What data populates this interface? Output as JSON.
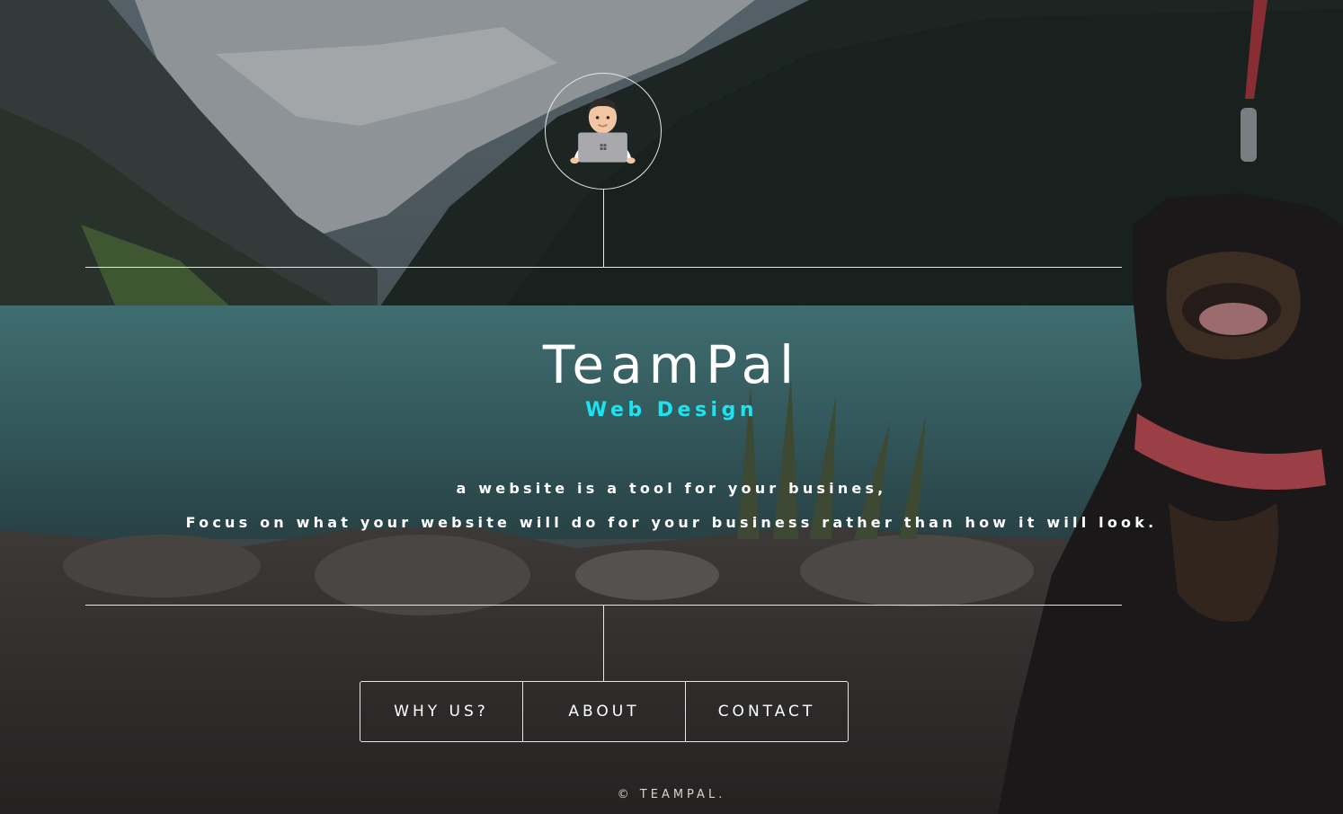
{
  "header": {
    "logo_alt": "TeamPal logo"
  },
  "brand": {
    "title": "TeamPal",
    "subtitle": "Web Design"
  },
  "intro": {
    "line1": "a website is a tool for your busines,",
    "line2": "Focus on what your website will do for your business rather than how it will look."
  },
  "nav": {
    "items": [
      {
        "label": "WHY US?"
      },
      {
        "label": "ABOUT"
      },
      {
        "label": "CONTACT"
      }
    ]
  },
  "footer": {
    "copyright": "© TEAMPAL."
  },
  "colors": {
    "accent": "#19e5f2",
    "text": "#ffffff",
    "line": "#e6e6e6"
  }
}
